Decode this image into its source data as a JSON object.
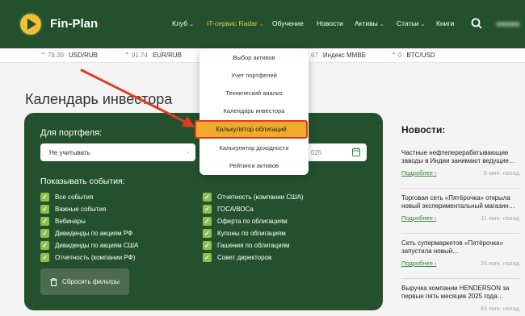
{
  "header": {
    "brand": "Fin-Plan",
    "nav": [
      {
        "label": "Клуб",
        "caret": "⌄"
      },
      {
        "label": "IT-сервис Radar",
        "caret": "⌄"
      },
      {
        "label": "Обучение",
        "caret": ""
      },
      {
        "label": "Новости",
        "caret": ""
      },
      {
        "label": "Активы",
        "caret": "⌄"
      },
      {
        "label": "Статьи",
        "caret": "⌄"
      },
      {
        "label": "Книги",
        "caret": ""
      }
    ],
    "icons": [
      "logo-icon",
      "search-icon"
    ],
    "colors": {
      "bg": "#24512d",
      "active": "#f0c24a"
    }
  },
  "ticker": [
    {
      "arrow": "⌃",
      "value": "78.39",
      "symbol": "USD/RUB"
    },
    {
      "arrow": "⌃",
      "value": "91.74",
      "symbol": "EUR/RUB"
    },
    {
      "arrow": "",
      "value": "67",
      "symbol": "Индекс ММВБ"
    },
    {
      "arrow": "⌃",
      "value": "0",
      "symbol": "BTC/USD"
    }
  ],
  "page": {
    "title": "Календарь инвестора",
    "portfolio_label": "Для портфеля:",
    "portfolio_value": "Не учитывать",
    "date_value": "025",
    "events_label": "Показывать события:",
    "events_left": [
      "Все события",
      "Важные события",
      "Вебинары",
      "Дивиденды по акциям РФ",
      "Дивиденды по акциям США",
      "Отчетность (компании РФ)"
    ],
    "events_right": [
      "Отчетность (компании США)",
      "ГОСА/ВОСа",
      "Оферта по облигациям",
      "Купоны по облигациям",
      "Гашения по облигациям",
      "Совет директоров"
    ],
    "reset_label": "Сбросить фильтры"
  },
  "news": {
    "title": "Новости:",
    "items": [
      {
        "text": "Частные нефтеперерабатывающие заводы в Индии занимают ведущие…",
        "more": "Подробнее ›",
        "time": "6 мин. назад"
      },
      {
        "text": "Торговая сеть «Пятёрочка» открыла новый экспериментальный магазин…",
        "more": "Подробнее ›",
        "time": "11 мин. назад"
      },
      {
        "text": "Сеть супермаркетов «Пятёрочка» запустила новый…",
        "more": "Подробнее ›",
        "time": "26 мин. назад"
      },
      {
        "text": "Выручка компании HENDERSON за первые пять месяцев 2025 года…",
        "more": "",
        "time": "43 мин. назад"
      }
    ]
  },
  "dropdown": {
    "items": [
      "Выбор активов",
      "Учет портфелей",
      "Технический анализ",
      "Календарь инвестора",
      "Калькулятор облигаций",
      "Калькулятор доходности",
      "Рейтинги активов"
    ],
    "highlighted_index": 4
  }
}
